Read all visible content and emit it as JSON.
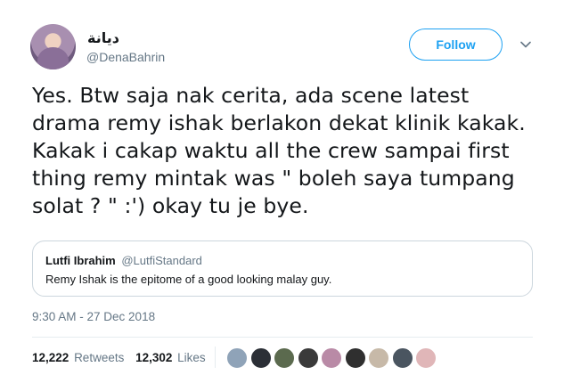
{
  "author": {
    "display_name": "ديانة",
    "handle": "@DenaBahrin",
    "avatar_icon": "profile-photo"
  },
  "actions": {
    "follow_label": "Follow",
    "more_icon": "chevron-down-icon"
  },
  "tweet": {
    "text": "Yes. Btw saja nak cerita, ada scene latest drama remy ishak berlakon dekat klinik kakak. Kakak i cakap waktu all the crew sampai first thing remy mintak was \" boleh saya tumpang solat ? \" :') okay tu je bye.",
    "timestamp": "9:30 AM - 27 Dec 2018"
  },
  "quoted_tweet": {
    "name": "Lutfi Ibrahim",
    "handle": "@LutfiStandard",
    "text": "Remy Ishak is the epitome of a good looking malay guy."
  },
  "stats": {
    "retweets_count": "12,222",
    "retweets_label": "Retweets",
    "likes_count": "12,302",
    "likes_label": "Likes"
  },
  "colors": {
    "accent": "#1da1f2",
    "secondary_text": "#657786",
    "border": "#ccd6dd"
  },
  "liker_faces": [
    "#8fa3b8",
    "#2b2f36",
    "#5b6a4e",
    "#3a3a3a",
    "#b98aa6",
    "#2f2f2f",
    "#c7b9a8",
    "#4a5560",
    "#e0b6b8"
  ]
}
